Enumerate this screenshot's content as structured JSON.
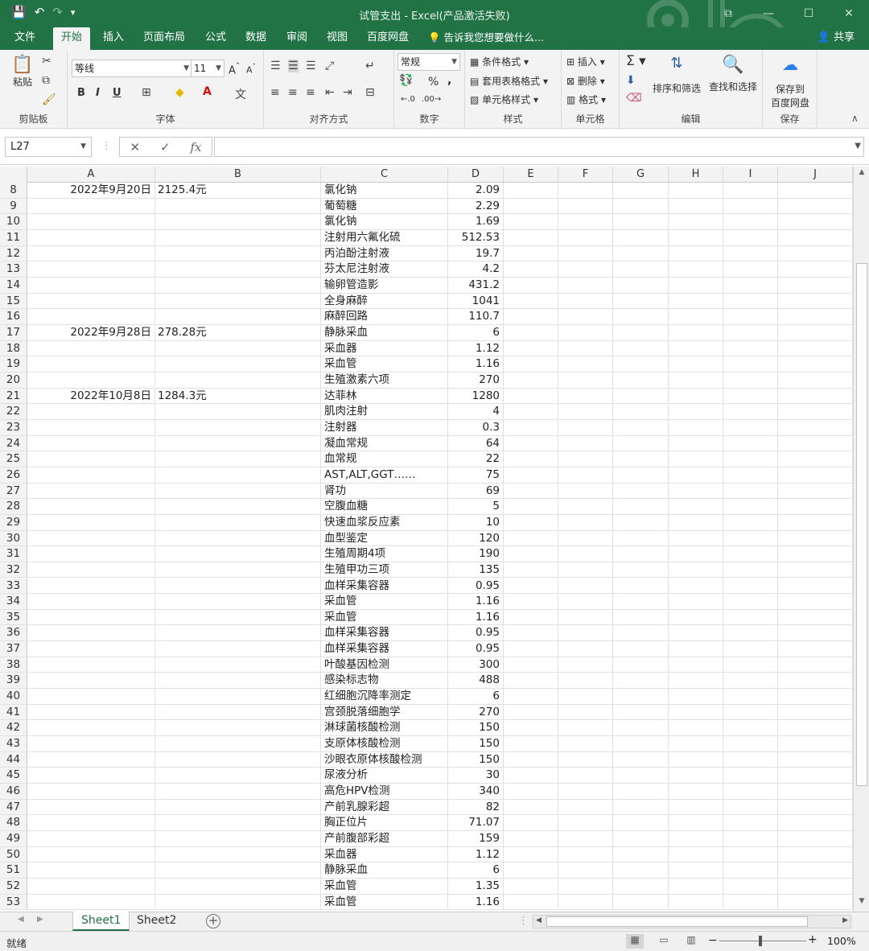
{
  "window": {
    "title": "试管支出 - Excel(产品激活失败)",
    "minimize": "—",
    "maximize": "☐",
    "close": "✕",
    "restore_icon": "⧉"
  },
  "qat": {
    "save": "💾",
    "undo": "↶",
    "redo": "↷",
    "customize": "▾"
  },
  "ribbon_tabs": {
    "file": "文件",
    "home": "开始",
    "insert": "插入",
    "page_layout": "页面布局",
    "formulas": "公式",
    "data": "数据",
    "review": "审阅",
    "view": "视图",
    "baidu": "百度网盘",
    "tell_me": "告诉我您想要做什么...",
    "share": "共享"
  },
  "ribbon": {
    "clipboard": {
      "paste": "粘贴",
      "label": "剪贴板"
    },
    "font": {
      "name": "等线",
      "size": "11",
      "bold": "B",
      "italic": "I",
      "underline": "U",
      "label": "字体"
    },
    "alignment": {
      "label": "对齐方式"
    },
    "number": {
      "format": "常规",
      "percent": "%",
      "comma": ",",
      "label": "数字"
    },
    "styles": {
      "conditional": "条件格式",
      "table": "套用表格格式",
      "cell_styles": "单元格样式",
      "label": "样式"
    },
    "cells": {
      "insert": "插入",
      "delete": "删除",
      "format": "格式",
      "label": "单元格"
    },
    "editing": {
      "sort": "排序和筛选",
      "find": "查找和选择",
      "label": "编辑"
    },
    "save": {
      "save_to": "保存到",
      "baidu": "百度网盘",
      "label": "保存"
    }
  },
  "formula_bar": {
    "name_box": "L27",
    "cancel": "✕",
    "enter": "✓",
    "fx": "fx",
    "value": ""
  },
  "columns": [
    "A",
    "B",
    "C",
    "D",
    "E",
    "F",
    "G",
    "H",
    "I",
    "J"
  ],
  "rows": [
    {
      "n": "8",
      "a": "2022年9月20日",
      "b": "2125.4元",
      "c": "氯化钠",
      "d": "2.09"
    },
    {
      "n": "9",
      "a": "",
      "b": "",
      "c": "葡萄糖",
      "d": "2.29"
    },
    {
      "n": "10",
      "a": "",
      "b": "",
      "c": "氯化钠",
      "d": "1.69"
    },
    {
      "n": "11",
      "a": "",
      "b": "",
      "c": "注射用六氟化硫",
      "d": "512.53"
    },
    {
      "n": "12",
      "a": "",
      "b": "",
      "c": "丙泊酚注射液",
      "d": "19.7"
    },
    {
      "n": "13",
      "a": "",
      "b": "",
      "c": "芬太尼注射液",
      "d": "4.2"
    },
    {
      "n": "14",
      "a": "",
      "b": "",
      "c": "输卵管造影",
      "d": "431.2"
    },
    {
      "n": "15",
      "a": "",
      "b": "",
      "c": "全身麻醉",
      "d": "1041"
    },
    {
      "n": "16",
      "a": "",
      "b": "",
      "c": "麻醉回路",
      "d": "110.7"
    },
    {
      "n": "17",
      "a": "2022年9月28日",
      "b": "278.28元",
      "c": "静脉采血",
      "d": "6"
    },
    {
      "n": "18",
      "a": "",
      "b": "",
      "c": "采血器",
      "d": "1.12"
    },
    {
      "n": "19",
      "a": "",
      "b": "",
      "c": "采血管",
      "d": "1.16"
    },
    {
      "n": "20",
      "a": "",
      "b": "",
      "c": "生殖激素六项",
      "d": "270"
    },
    {
      "n": "21",
      "a": "2022年10月8日",
      "b": "1284.3元",
      "c": "达菲林",
      "d": "1280"
    },
    {
      "n": "22",
      "a": "",
      "b": "",
      "c": "肌肉注射",
      "d": "4"
    },
    {
      "n": "23",
      "a": "",
      "b": "",
      "c": "注射器",
      "d": "0.3"
    },
    {
      "n": "24",
      "a": "",
      "b": "",
      "c": "凝血常规",
      "d": "64"
    },
    {
      "n": "25",
      "a": "",
      "b": "",
      "c": "血常规",
      "d": "22"
    },
    {
      "n": "26",
      "a": "",
      "b": "",
      "c": "AST,ALT,GGT……",
      "d": "75"
    },
    {
      "n": "27",
      "a": "",
      "b": "",
      "c": "肾功",
      "d": "69"
    },
    {
      "n": "28",
      "a": "",
      "b": "",
      "c": "空腹血糖",
      "d": "5"
    },
    {
      "n": "29",
      "a": "",
      "b": "",
      "c": "快速血浆反应素",
      "d": "10"
    },
    {
      "n": "30",
      "a": "",
      "b": "",
      "c": "血型鉴定",
      "d": "120"
    },
    {
      "n": "31",
      "a": "",
      "b": "",
      "c": "生殖周期4项",
      "d": "190"
    },
    {
      "n": "32",
      "a": "",
      "b": "",
      "c": "生殖甲功三项",
      "d": "135"
    },
    {
      "n": "33",
      "a": "",
      "b": "",
      "c": "血样采集容器",
      "d": "0.95"
    },
    {
      "n": "34",
      "a": "",
      "b": "",
      "c": "采血管",
      "d": "1.16"
    },
    {
      "n": "35",
      "a": "",
      "b": "",
      "c": "采血管",
      "d": "1.16"
    },
    {
      "n": "36",
      "a": "",
      "b": "",
      "c": "血样采集容器",
      "d": "0.95"
    },
    {
      "n": "37",
      "a": "",
      "b": "",
      "c": "血样采集容器",
      "d": "0.95"
    },
    {
      "n": "38",
      "a": "",
      "b": "",
      "c": "叶酸基因检测",
      "d": "300"
    },
    {
      "n": "39",
      "a": "",
      "b": "",
      "c": "感染标志物",
      "d": "488"
    },
    {
      "n": "40",
      "a": "",
      "b": "",
      "c": "红细胞沉降率测定",
      "d": "6"
    },
    {
      "n": "41",
      "a": "",
      "b": "",
      "c": "宫颈脱落细胞学",
      "d": "270"
    },
    {
      "n": "42",
      "a": "",
      "b": "",
      "c": "淋球菌核酸检测",
      "d": "150"
    },
    {
      "n": "43",
      "a": "",
      "b": "",
      "c": "支原体核酸检测",
      "d": "150"
    },
    {
      "n": "44",
      "a": "",
      "b": "",
      "c": "沙眼衣原体核酸检测",
      "d": "150"
    },
    {
      "n": "45",
      "a": "",
      "b": "",
      "c": "尿液分析",
      "d": "30"
    },
    {
      "n": "46",
      "a": "",
      "b": "",
      "c": "高危HPV检测",
      "d": "340"
    },
    {
      "n": "47",
      "a": "",
      "b": "",
      "c": "产前乳腺彩超",
      "d": "82"
    },
    {
      "n": "48",
      "a": "",
      "b": "",
      "c": "胸正位片",
      "d": "71.07"
    },
    {
      "n": "49",
      "a": "",
      "b": "",
      "c": "产前腹部彩超",
      "d": "159"
    },
    {
      "n": "50",
      "a": "",
      "b": "",
      "c": "采血器",
      "d": "1.12"
    },
    {
      "n": "51",
      "a": "",
      "b": "",
      "c": "静脉采血",
      "d": "6"
    },
    {
      "n": "52",
      "a": "",
      "b": "",
      "c": "采血管",
      "d": "1.35"
    },
    {
      "n": "53",
      "a": "",
      "b": "",
      "c": "采血管",
      "d": "1.16"
    }
  ],
  "sheets": [
    "Sheet1",
    "Sheet2"
  ],
  "add_sheet": "+",
  "status": {
    "ready": "就绪",
    "zoom": "100%",
    "zoom_out": "−",
    "zoom_in": "+"
  },
  "colors": {
    "accent": "#217346"
  }
}
